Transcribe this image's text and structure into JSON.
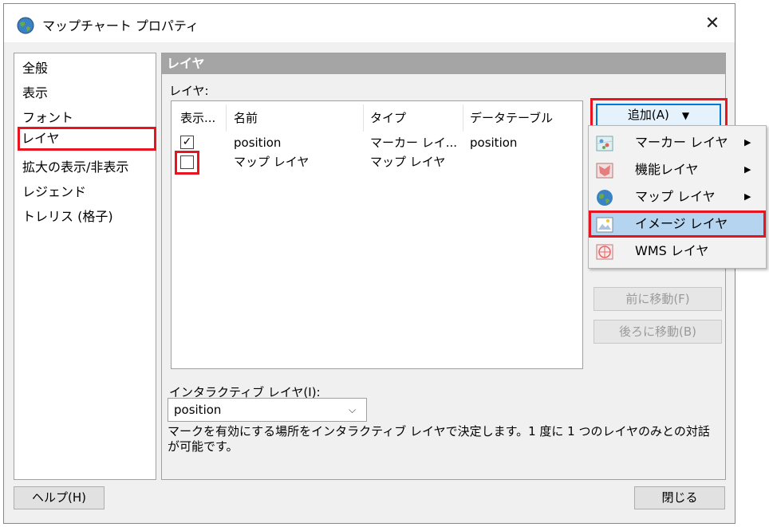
{
  "window": {
    "title": "マップチャート プロパティ",
    "close_glyph": "✕",
    "icon": "globe-icon"
  },
  "nav": {
    "items": [
      "全般",
      "表示",
      "フォント",
      "レイヤ",
      "拡大の表示/非表示",
      "レジェンド",
      "トレリス (格子)"
    ],
    "selected": "レイヤ"
  },
  "panel": {
    "header": "レイヤ",
    "layers_label": "レイヤ:",
    "columns": [
      "表示...",
      "名前",
      "タイプ",
      "データテーブル"
    ],
    "rows": [
      {
        "visible": true,
        "name": "position",
        "type": "マーカー レイ...",
        "table": "position"
      },
      {
        "visible": false,
        "name": "マップ レイヤ",
        "type": "マップ レイヤ",
        "table": ""
      }
    ],
    "check_glyph": "✓",
    "add_button": "追加(A)",
    "add_arrow": "▼",
    "move_up": "前に移動(F)",
    "move_down": "後ろに移動(B)",
    "interactive_label": "インタラクティブ レイヤ(I):",
    "interactive_value": "position",
    "combo_arrow": "⌵",
    "description": "マークを有効にする場所をインタラクティブ レイヤで決定します。1 度に 1 つのレイヤのみとの対話が可能です。"
  },
  "add_menu": {
    "items": [
      {
        "label": "マーカー レイヤ",
        "submenu": true,
        "icon": "marker-layer-icon"
      },
      {
        "label": "機能レイヤ",
        "submenu": true,
        "icon": "feature-layer-icon"
      },
      {
        "label": "マップ レイヤ",
        "submenu": true,
        "icon": "globe-icon"
      },
      {
        "label": "イメージ レイヤ",
        "submenu": false,
        "icon": "image-layer-icon",
        "highlighted": true
      },
      {
        "label": "WMS レイヤ",
        "submenu": false,
        "icon": "wms-layer-icon"
      }
    ],
    "submenu_arrow": "▶"
  },
  "footer": {
    "help_button": "ヘルプ(H)",
    "close_button": "閉じる"
  },
  "colors": {
    "highlight_red": "#e8141f",
    "focus_blue": "#0078d7",
    "menu_highlight": "#b4d4f0",
    "panel_header": "#a5a5a5"
  }
}
